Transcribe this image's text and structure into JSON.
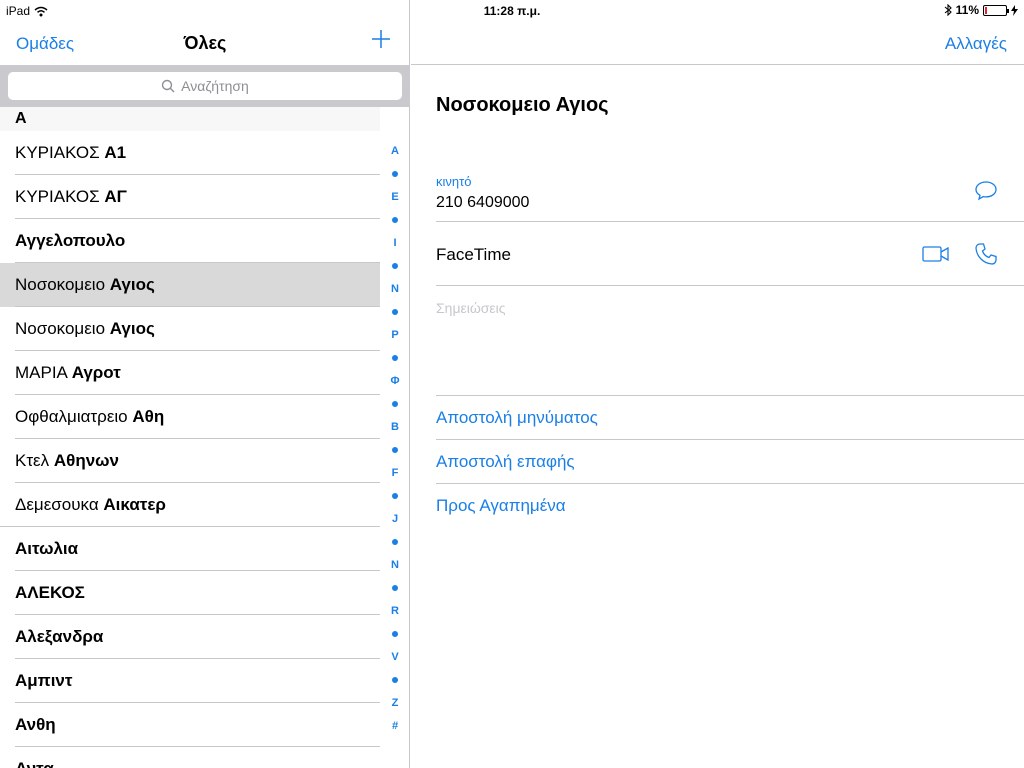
{
  "status_bar": {
    "device": "iPad",
    "time": "11:28 π.μ.",
    "battery": "11%",
    "battery_level": 0.11
  },
  "left_nav": {
    "groups_label": "Ομάδες",
    "title": "Όλες"
  },
  "search": {
    "placeholder": "Αναζήτηση"
  },
  "contacts": {
    "section": "A",
    "rows": [
      {
        "first": "ΚΥΡΙΑΚΟΣ ",
        "last": "Α1"
      },
      {
        "first": "ΚΥΡΙΑΚΟΣ ",
        "last": "ΑΓ"
      },
      {
        "first": "",
        "last": "Αγγελοπουλο"
      },
      {
        "first": "Νοσοκομειο ",
        "last": "Αγιος"
      },
      {
        "first": "Νοσοκομειο ",
        "last": "Αγιος"
      },
      {
        "first": "ΜΑΡΙΑ ",
        "last": "Αγροτ"
      },
      {
        "first": "Οφθαλμιατρειο ",
        "last": "Αθη"
      },
      {
        "first": "Κτελ ",
        "last": "Αθηνων"
      },
      {
        "first": "Δεμεσουκα ",
        "last": "Αικατερ"
      },
      {
        "first": "",
        "last": "Αιτωλια"
      },
      {
        "first": "",
        "last": "ΑΛΕΚΟΣ"
      },
      {
        "first": "",
        "last": "Αλεξανδρα"
      },
      {
        "first": "",
        "last": "Αμπιντ"
      },
      {
        "first": "",
        "last": "Ανθη"
      },
      {
        "first": "",
        "last": "Αντα"
      }
    ]
  },
  "index_letters": [
    "A",
    "E",
    "I",
    "N",
    "P",
    "Φ",
    "B",
    "F",
    "J",
    "N",
    "R",
    "V",
    "Z",
    "#"
  ],
  "right_nav": {
    "edit_label": "Αλλαγές"
  },
  "detail": {
    "name": "Νοσοκομειο Αγιος",
    "phone_label": "κινητό",
    "phone_value": "210 6409000",
    "facetime_label": "FaceTime",
    "notes_placeholder": "Σημειώσεις",
    "actions": [
      "Αποστολή μηνύματος",
      "Αποστολή επαφής",
      "Προς Αγαπημένα"
    ]
  },
  "colors": {
    "accent": "#1a7fe6",
    "selected_row": "#d9d9d9",
    "battery_low": "#e0262f"
  }
}
